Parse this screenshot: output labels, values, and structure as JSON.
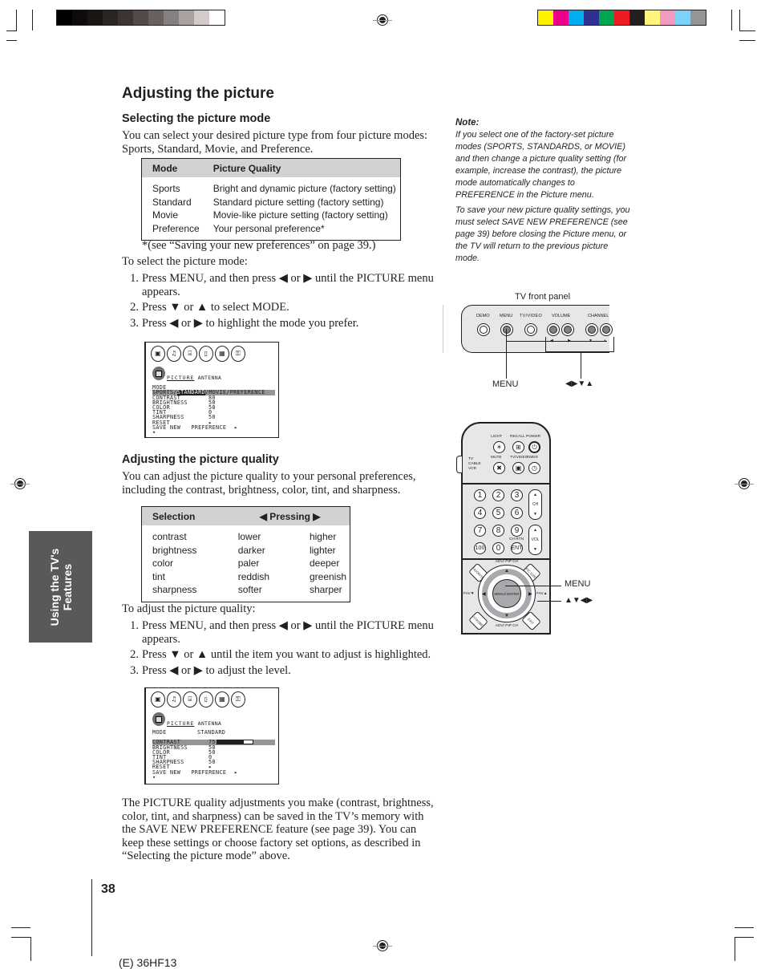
{
  "print_marks": {
    "grayscale_swatches": [
      "#000000",
      "#0d0b0b",
      "#1a1614",
      "#2a2422",
      "#3d3432",
      "#534a47",
      "#6a615e",
      "#858080",
      "#a9a2a0",
      "#d2cbc9",
      "#ffffff"
    ],
    "color_swatches": [
      "#fff200",
      "#ec008c",
      "#00aeef",
      "#2e3192",
      "#00a651",
      "#ed1c24",
      "#231f20",
      "#fff57d",
      "#f49ac1",
      "#7dd3f7",
      "#959595"
    ]
  },
  "page": {
    "title": "Adjusting the picture",
    "side_tab": [
      "Using the TV's",
      "Features"
    ],
    "page_number": "38",
    "footer": "(E) 36HF13"
  },
  "section_mode": {
    "heading": "Selecting the picture mode",
    "intro": "You can select your desired picture type from four picture modes: Sports, Standard, Movie, and Preference.",
    "table": {
      "headers": [
        "Mode",
        "Picture Quality"
      ],
      "rows": [
        [
          "Sports",
          "Bright and dynamic picture (factory setting)"
        ],
        [
          "Standard",
          "Standard picture setting (factory setting)"
        ],
        [
          "Movie",
          "Movie-like picture setting (factory setting)"
        ],
        [
          "Preference",
          "Your personal preference*"
        ]
      ]
    },
    "footnote": "*(see “Saving your new preferences” on page 39.)",
    "steps_intro": "To select the picture mode:",
    "steps": [
      "Press MENU, and then press ◀ or ▶ until the PICTURE menu appears.",
      "Press ▼ or ▲ to select MODE.",
      "Press ◀ or ▶ to highlight the mode you prefer."
    ]
  },
  "osd_mode": {
    "icons": [
      "picture-icon",
      "audio-icon",
      "setup-icon",
      "option-icon",
      "lock-icon",
      "theater-icon"
    ],
    "header": [
      "PICTURE",
      "ANTENNA"
    ],
    "mode_label": "MODE",
    "mode_options": [
      "SPORTS",
      "STANDARD",
      "MOVIE",
      "PREFERENCE"
    ],
    "selected_mode": "STANDARD",
    "items": [
      {
        "label": "CONTRAST",
        "value": "80"
      },
      {
        "label": "BRIGHTNESS",
        "value": "50"
      },
      {
        "label": "COLOR",
        "value": "50"
      },
      {
        "label": "TINT",
        "value": "0"
      },
      {
        "label": "SHARPNESS",
        "value": "50"
      },
      {
        "label": "RESET",
        "value": "▸"
      },
      {
        "label": "SAVE NEW   PREFERENCE",
        "value": "▸"
      }
    ],
    "more_arrow": "▾"
  },
  "section_quality": {
    "heading": "Adjusting the picture quality",
    "intro": "You can adjust the picture quality to your personal preferences, including the contrast, brightness, color, tint, and sharpness.",
    "table": {
      "headers": [
        "Selection",
        "◀  Pressing  ▶"
      ],
      "rows": [
        [
          "contrast",
          "lower",
          "higher"
        ],
        [
          "brightness",
          "darker",
          "lighter"
        ],
        [
          "color",
          "paler",
          "deeper"
        ],
        [
          "tint",
          "reddish",
          "greenish"
        ],
        [
          "sharpness",
          "softer",
          "sharper"
        ]
      ]
    },
    "steps_intro": "To adjust the picture quality:",
    "steps": [
      "Press MENU, and then press ◀ or ▶ until the PICTURE menu appears.",
      "Press ▼ or ▲ until the item you want to adjust is highlighted.",
      "Press ◀ or ▶ to adjust the level."
    ],
    "closing": "The PICTURE quality adjustments you make (contrast, brightness, color, tint, and sharpness) can be saved in the TV’s memory with the SAVE NEW PREFERENCE feature (see page 39). You can keep these settings or choose factory set options, as described in “Selecting the picture mode” above."
  },
  "osd_quality": {
    "header": [
      "PICTURE",
      "ANTENNA"
    ],
    "mode_label": "MODE",
    "mode_value": "STANDARD",
    "items": [
      {
        "label": "CONTRAST",
        "value": "75"
      },
      {
        "label": "BRIGHTNESS",
        "value": "50"
      },
      {
        "label": "COLOR",
        "value": "50"
      },
      {
        "label": "TINT",
        "value": "0"
      },
      {
        "label": "SHARPNESS",
        "value": "50"
      },
      {
        "label": "RESET",
        "value": "▸"
      },
      {
        "label": "SAVE NEW   PREFERENCE",
        "value": "▸"
      }
    ],
    "contrast_level_fraction": 0.75,
    "more_arrow": "▾"
  },
  "note": {
    "label": "Note:",
    "paragraphs": [
      "If you select one of the factory-set picture modes (SPORTS, STANDARDS, or MOVIE) and then change a picture quality setting (for example, increase the contrast), the picture mode automatically changes to PREFERENCE in the Picture menu.",
      "To save your new picture quality settings, you must select SAVE NEW PREFERENCE (see page 39) before closing the Picture menu, or the TV will return to the previous picture mode."
    ]
  },
  "front_panel": {
    "caption": "TV front panel",
    "buttons": [
      "DEMO",
      "MENU",
      "TV/VIDEO",
      "VOLUME",
      "CHANNEL"
    ],
    "arrow_marks": [
      "◀",
      "▶",
      "▼",
      "▲"
    ],
    "callout_menu": "MENU",
    "callout_arrows": "◀▶▼▲"
  },
  "remote": {
    "switch_labels": [
      "TV",
      "CABLE",
      "VCR"
    ],
    "top_buttons": [
      {
        "label": "LIGHT",
        "glyph": "☀"
      },
      {
        "label": "RECALL",
        "glyph": "⊞"
      },
      {
        "label": "POWER",
        "glyph": "⏻"
      },
      {
        "label": "MUTE",
        "glyph": "✖"
      },
      {
        "label": "TV/VIDEO",
        "glyph": "▣"
      },
      {
        "label": "TIMER",
        "glyph": "◷"
      }
    ],
    "number_keys": [
      "1",
      "2",
      "3",
      "4",
      "5",
      "6",
      "7",
      "8",
      "9",
      "100",
      "0",
      "ENT"
    ],
    "ch_label": "CH",
    "vol_label": "VOL",
    "ch_rtn_label": "CH RTN",
    "dpad_up_label": "ADV/ PIP CH",
    "dpad_down_label": "ADV/ PIP CH",
    "dpad_left_label": "FAV▼",
    "dpad_right_label": "FAV▲",
    "center_label": "MENU/ ENTER",
    "corner_buttons": [
      "FAVORITE",
      "PIC SIZE",
      "STROBE",
      "EXIT"
    ],
    "callout_menu": "MENU",
    "callout_arrows": "▲▼◀▶"
  }
}
